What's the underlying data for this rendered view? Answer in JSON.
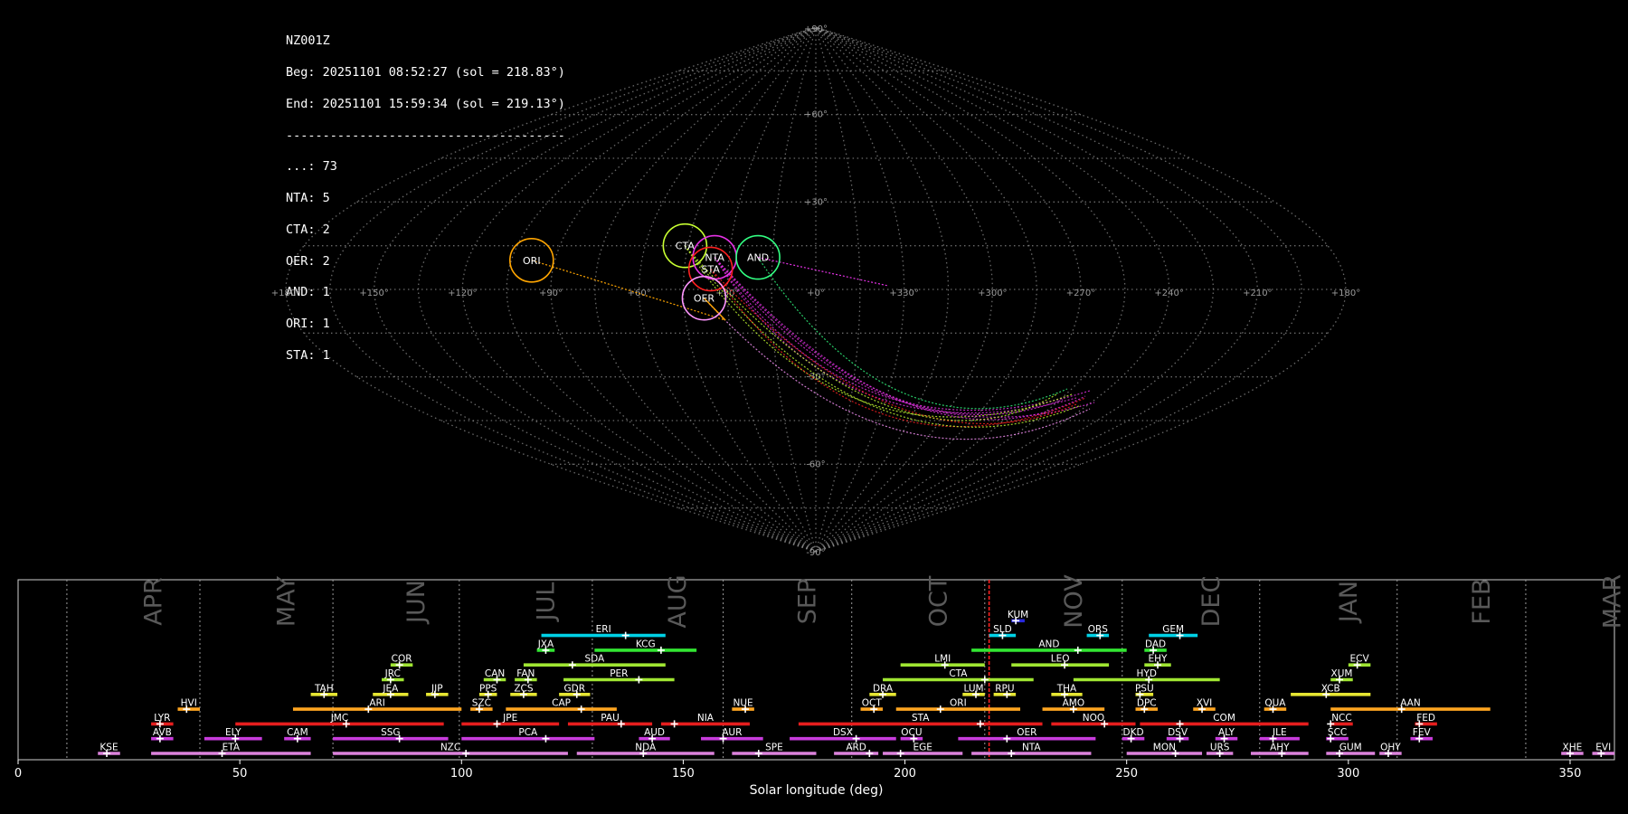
{
  "summary": {
    "station": "NZ001Z",
    "begin": "Beg: 20251101 08:52:27 (sol = 218.83°)",
    "end": "End: 20251101 15:59:34 (sol = 219.13°)",
    "separator": "--------------------------------------",
    "counts": [
      "...: 73",
      "NTA: 5",
      "CTA: 2",
      "OER: 2",
      "AND: 1",
      "ORI: 1",
      "STA: 1"
    ]
  },
  "colors": {
    "grid": "#8c8c8c",
    "marker": "#ff2020",
    "ORI": "#ffa500",
    "CTA": "#c8ff32",
    "NTA": "#e632e6",
    "STA": "#ff2020",
    "AND": "#32ff82",
    "OER": "#ff96ff",
    "cyan": "#00d2e6",
    "green": "#32e632",
    "lime": "#a0e632",
    "yellow": "#e6e632",
    "orange": "#ffa520",
    "red": "#e61e1e",
    "purple": "#c83cdc",
    "pink": "#dc82dc",
    "blue": "#2828dc"
  },
  "sky_map": {
    "projection": "sinusoidal",
    "lon_labels": [
      "+180°",
      "+150°",
      "+120°",
      "+90°",
      "+60°",
      "+30°",
      "+0°",
      "+330°",
      "+300°",
      "+270°",
      "+240°",
      "+210°",
      "+180°"
    ],
    "lat_labels": [
      "+90°",
      "+60°",
      "+30°",
      "-30°",
      "-60°",
      "-90°"
    ],
    "radiants": [
      {
        "code": "ORI",
        "lon": 98,
        "lat": 10,
        "color": "ORI"
      },
      {
        "code": "CTA",
        "lon": 46,
        "lat": 15,
        "color": "CTA"
      },
      {
        "code": "NTA",
        "lon": 35,
        "lat": 11,
        "color": "NTA"
      },
      {
        "code": "STA",
        "lon": 36,
        "lat": 7,
        "color": "STA"
      },
      {
        "code": "AND",
        "lon": 20,
        "lat": 11,
        "color": "AND"
      },
      {
        "code": "OER",
        "lon": 38,
        "lat": -3,
        "color": "OER"
      }
    ]
  },
  "chart_data": {
    "type": "timeline",
    "xlabel": "Solar longitude (deg)",
    "xlim": [
      0,
      360
    ],
    "xticks": [
      0,
      50,
      100,
      150,
      200,
      250,
      300,
      350
    ],
    "current_sol": 218.98,
    "months": [
      {
        "name": "APR",
        "start": 11,
        "end": 41
      },
      {
        "name": "MAY",
        "start": 41,
        "end": 71
      },
      {
        "name": "JUN",
        "start": 71,
        "end": 99.5
      },
      {
        "name": "JUL",
        "start": 99.5,
        "end": 129.5
      },
      {
        "name": "AUG",
        "start": 129.5,
        "end": 159
      },
      {
        "name": "SEP",
        "start": 159,
        "end": 188
      },
      {
        "name": "OCT",
        "start": 188,
        "end": 218
      },
      {
        "name": "NOV",
        "start": 218,
        "end": 249
      },
      {
        "name": "DEC",
        "start": 249,
        "end": 280
      },
      {
        "name": "JAN",
        "start": 280,
        "end": 311
      },
      {
        "name": "FEB",
        "start": 311,
        "end": 340
      },
      {
        "name": "MAR",
        "start": 340,
        "end": 371
      }
    ],
    "showers": [
      {
        "code": "KUM",
        "start": 224,
        "end": 227,
        "peak": 225,
        "row": 9,
        "color": "blue"
      },
      {
        "code": "ERI",
        "start": 118,
        "end": 146,
        "peak": 137,
        "row": 8,
        "color": "cyan"
      },
      {
        "code": "SLD",
        "start": 219,
        "end": 225,
        "peak": 222,
        "row": 8,
        "color": "cyan"
      },
      {
        "code": "ORS",
        "start": 241,
        "end": 246,
        "peak": 244,
        "row": 8,
        "color": "cyan"
      },
      {
        "code": "GEM",
        "start": 255,
        "end": 266,
        "peak": 262,
        "row": 8,
        "color": "cyan"
      },
      {
        "code": "JXA",
        "start": 117,
        "end": 121,
        "peak": 119,
        "row": 7,
        "color": "green"
      },
      {
        "code": "KCG",
        "start": 130,
        "end": 153,
        "peak": 145,
        "row": 7,
        "color": "green"
      },
      {
        "code": "AND",
        "start": 215,
        "end": 250,
        "peak": 239,
        "row": 7,
        "color": "green"
      },
      {
        "code": "DAD",
        "start": 254,
        "end": 259,
        "peak": 256,
        "row": 7,
        "color": "green"
      },
      {
        "code": "COR",
        "start": 84,
        "end": 89,
        "peak": 86,
        "row": 6,
        "color": "lime"
      },
      {
        "code": "SDA",
        "start": 114,
        "end": 146,
        "peak": 125,
        "row": 6,
        "color": "lime"
      },
      {
        "code": "LMI",
        "start": 199,
        "end": 218,
        "peak": 209,
        "row": 6,
        "color": "lime"
      },
      {
        "code": "LEO",
        "start": 224,
        "end": 246,
        "peak": 236,
        "row": 6,
        "color": "lime"
      },
      {
        "code": "EHY",
        "start": 254,
        "end": 260,
        "peak": 257,
        "row": 6,
        "color": "lime"
      },
      {
        "code": "ECV",
        "start": 300,
        "end": 305,
        "peak": 302,
        "row": 6,
        "color": "lime"
      },
      {
        "code": "JRC",
        "start": 82,
        "end": 87,
        "peak": 84,
        "row": 5,
        "color": "lime"
      },
      {
        "code": "CAN",
        "start": 105,
        "end": 110,
        "peak": 108,
        "row": 5,
        "color": "lime"
      },
      {
        "code": "FAN",
        "start": 112,
        "end": 117,
        "peak": 115,
        "row": 5,
        "color": "lime"
      },
      {
        "code": "PER",
        "start": 123,
        "end": 148,
        "peak": 140,
        "row": 5,
        "color": "lime"
      },
      {
        "code": "CTA",
        "start": 195,
        "end": 229,
        "peak": 218,
        "row": 5,
        "color": "lime"
      },
      {
        "code": "HYD",
        "start": 238,
        "end": 271,
        "peak": 255,
        "row": 5,
        "color": "lime"
      },
      {
        "code": "XUM",
        "start": 296,
        "end": 301,
        "peak": 298,
        "row": 5,
        "color": "lime"
      },
      {
        "code": "TAH",
        "start": 66,
        "end": 72,
        "peak": 69,
        "row": 4,
        "color": "yellow"
      },
      {
        "code": "JEA",
        "start": 80,
        "end": 88,
        "peak": 84,
        "row": 4,
        "color": "yellow"
      },
      {
        "code": "JIP",
        "start": 92,
        "end": 97,
        "peak": 94,
        "row": 4,
        "color": "yellow"
      },
      {
        "code": "PPS",
        "start": 104,
        "end": 108,
        "peak": 106,
        "row": 4,
        "color": "yellow"
      },
      {
        "code": "ZCS",
        "start": 111,
        "end": 117,
        "peak": 114,
        "row": 4,
        "color": "yellow"
      },
      {
        "code": "GDR",
        "start": 122,
        "end": 129,
        "peak": 126,
        "row": 4,
        "color": "yellow"
      },
      {
        "code": "DRA",
        "start": 192,
        "end": 198,
        "peak": 195,
        "row": 4,
        "color": "yellow"
      },
      {
        "code": "LUM",
        "start": 213,
        "end": 218,
        "peak": 216,
        "row": 4,
        "color": "yellow"
      },
      {
        "code": "RPU",
        "start": 220,
        "end": 225,
        "peak": 223,
        "row": 4,
        "color": "yellow"
      },
      {
        "code": "THA",
        "start": 233,
        "end": 240,
        "peak": 236,
        "row": 4,
        "color": "yellow"
      },
      {
        "code": "PSU",
        "start": 252,
        "end": 256,
        "peak": 253,
        "row": 4,
        "color": "yellow"
      },
      {
        "code": "XCB",
        "start": 287,
        "end": 305,
        "peak": 295,
        "row": 4,
        "color": "yellow"
      },
      {
        "code": "HVI",
        "start": 36,
        "end": 41,
        "peak": 38,
        "row": 3,
        "color": "orange"
      },
      {
        "code": "ARI",
        "start": 62,
        "end": 100,
        "peak": 79,
        "row": 3,
        "color": "orange"
      },
      {
        "code": "SZC",
        "start": 102,
        "end": 107,
        "peak": 104,
        "row": 3,
        "color": "orange"
      },
      {
        "code": "CAP",
        "start": 110,
        "end": 135,
        "peak": 127,
        "row": 3,
        "color": "orange"
      },
      {
        "code": "NUE",
        "start": 161,
        "end": 166,
        "peak": 164,
        "row": 3,
        "color": "orange"
      },
      {
        "code": "OCT",
        "start": 190,
        "end": 195,
        "peak": 193,
        "row": 3,
        "color": "orange"
      },
      {
        "code": "ORI",
        "start": 198,
        "end": 226,
        "peak": 208,
        "row": 3,
        "color": "orange"
      },
      {
        "code": "AMO",
        "start": 231,
        "end": 245,
        "peak": 238,
        "row": 3,
        "color": "orange"
      },
      {
        "code": "DPC",
        "start": 252,
        "end": 257,
        "peak": 254,
        "row": 3,
        "color": "orange"
      },
      {
        "code": "XVI",
        "start": 265,
        "end": 270,
        "peak": 267,
        "row": 3,
        "color": "orange"
      },
      {
        "code": "QUA",
        "start": 281,
        "end": 286,
        "peak": 283,
        "row": 3,
        "color": "orange"
      },
      {
        "code": "AAN",
        "start": 296,
        "end": 332,
        "peak": 312,
        "row": 3,
        "color": "orange"
      },
      {
        "code": "LYR",
        "start": 30,
        "end": 35,
        "peak": 32,
        "row": 2,
        "color": "red"
      },
      {
        "code": "JMC",
        "start": 49,
        "end": 96,
        "peak": 74,
        "row": 2,
        "color": "red"
      },
      {
        "code": "JPE",
        "start": 100,
        "end": 122,
        "peak": 108,
        "row": 2,
        "color": "red"
      },
      {
        "code": "PAU",
        "start": 124,
        "end": 143,
        "peak": 136,
        "row": 2,
        "color": "red"
      },
      {
        "code": "NIA",
        "start": 145,
        "end": 165,
        "peak": 148,
        "row": 2,
        "color": "red"
      },
      {
        "code": "STA",
        "start": 176,
        "end": 231,
        "peak": 217,
        "row": 2,
        "color": "red"
      },
      {
        "code": "NOO",
        "start": 233,
        "end": 252,
        "peak": 245,
        "row": 2,
        "color": "red"
      },
      {
        "code": "COM",
        "start": 253,
        "end": 291,
        "peak": 262,
        "row": 2,
        "color": "red"
      },
      {
        "code": "NCC",
        "start": 296,
        "end": 301,
        "peak": 296,
        "row": 2,
        "color": "red"
      },
      {
        "code": "FED",
        "start": 315,
        "end": 320,
        "peak": 316,
        "row": 2,
        "color": "red"
      },
      {
        "code": "AVB",
        "start": 30,
        "end": 35,
        "peak": 32,
        "row": 1,
        "color": "purple"
      },
      {
        "code": "ELY",
        "start": 42,
        "end": 55,
        "peak": 49,
        "row": 1,
        "color": "purple"
      },
      {
        "code": "CAM",
        "start": 60,
        "end": 66,
        "peak": 63,
        "row": 1,
        "color": "purple"
      },
      {
        "code": "SSG",
        "start": 71,
        "end": 97,
        "peak": 86,
        "row": 1,
        "color": "purple"
      },
      {
        "code": "PCA",
        "start": 100,
        "end": 130,
        "peak": 119,
        "row": 1,
        "color": "purple"
      },
      {
        "code": "AUD",
        "start": 140,
        "end": 147,
        "peak": 143,
        "row": 1,
        "color": "purple"
      },
      {
        "code": "AUR",
        "start": 154,
        "end": 168,
        "peak": 159,
        "row": 1,
        "color": "purple"
      },
      {
        "code": "DSX",
        "start": 174,
        "end": 198,
        "peak": 189,
        "row": 1,
        "color": "purple"
      },
      {
        "code": "OCU",
        "start": 199,
        "end": 204,
        "peak": 202,
        "row": 1,
        "color": "purple"
      },
      {
        "code": "OER",
        "start": 212,
        "end": 243,
        "peak": 223,
        "row": 1,
        "color": "purple"
      },
      {
        "code": "DKD",
        "start": 249,
        "end": 254,
        "peak": 251,
        "row": 1,
        "color": "purple"
      },
      {
        "code": "DSV",
        "start": 259,
        "end": 264,
        "peak": 262,
        "row": 1,
        "color": "purple"
      },
      {
        "code": "ALY",
        "start": 270,
        "end": 275,
        "peak": 272,
        "row": 1,
        "color": "purple"
      },
      {
        "code": "ILE",
        "start": 280,
        "end": 289,
        "peak": 283,
        "row": 1,
        "color": "purple"
      },
      {
        "code": "SCC",
        "start": 295,
        "end": 300,
        "peak": 296,
        "row": 1,
        "color": "purple"
      },
      {
        "code": "FEV",
        "start": 314,
        "end": 319,
        "peak": 316,
        "row": 1,
        "color": "purple"
      },
      {
        "code": "KSE",
        "start": 18,
        "end": 23,
        "peak": 20,
        "row": 0,
        "color": "pink"
      },
      {
        "code": "ETA",
        "start": 30,
        "end": 66,
        "peak": 46,
        "row": 0,
        "color": "pink"
      },
      {
        "code": "NZC",
        "start": 71,
        "end": 124,
        "peak": 101,
        "row": 0,
        "color": "pink"
      },
      {
        "code": "NDA",
        "start": 126,
        "end": 157,
        "peak": 141,
        "row": 0,
        "color": "pink"
      },
      {
        "code": "SPE",
        "start": 161,
        "end": 180,
        "peak": 167,
        "row": 0,
        "color": "pink"
      },
      {
        "code": "ARD",
        "start": 184,
        "end": 194,
        "peak": 192,
        "row": 0,
        "color": "pink"
      },
      {
        "code": "EGE",
        "start": 195,
        "end": 213,
        "peak": 199,
        "row": 0,
        "color": "pink"
      },
      {
        "code": "NTA",
        "start": 215,
        "end": 242,
        "peak": 224,
        "row": 0,
        "color": "pink"
      },
      {
        "code": "MON",
        "start": 250,
        "end": 267,
        "peak": 261,
        "row": 0,
        "color": "pink"
      },
      {
        "code": "URS",
        "start": 268,
        "end": 274,
        "peak": 271,
        "row": 0,
        "color": "pink"
      },
      {
        "code": "AHY",
        "start": 278,
        "end": 291,
        "peak": 285,
        "row": 0,
        "color": "pink"
      },
      {
        "code": "GUM",
        "start": 295,
        "end": 306,
        "peak": 298,
        "row": 0,
        "color": "pink"
      },
      {
        "code": "OHY",
        "start": 307,
        "end": 312,
        "peak": 309,
        "row": 0,
        "color": "pink"
      },
      {
        "code": "XHE",
        "start": 348,
        "end": 353,
        "peak": 350,
        "row": 0,
        "color": "pink"
      },
      {
        "code": "EVI",
        "start": 355,
        "end": 360,
        "peak": 357,
        "row": 0,
        "color": "pink"
      }
    ]
  }
}
